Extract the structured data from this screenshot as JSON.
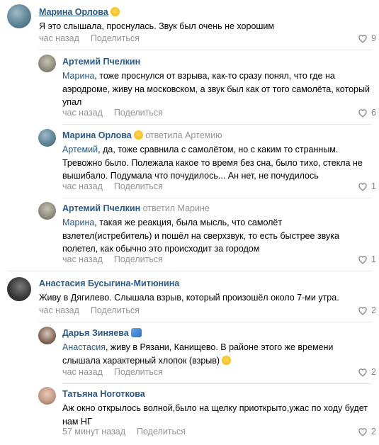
{
  "colors": {
    "link": "#2a5885",
    "meta": "#939393",
    "divider": "#e7e8ec"
  },
  "comments": [
    {
      "author": "Марина Орлова",
      "reply_to": "",
      "text_mention": "",
      "text": "Я это слышала, проснулась. Звук был очень не хорошим",
      "time": "час назад",
      "share": "Поделиться",
      "likes": "9",
      "avatar_icon": "avatar-photo",
      "badge_icon": "smiley-emoji"
    },
    {
      "author": "Артемий Пчелкин",
      "reply_to": "",
      "text_mention": "Марина",
      "text": ", тоже проснулся от взрыва, как-то сразу понял, что где на аэродроме, живу на московском, а звук был как от того самолёта, который упал",
      "time": "час назад",
      "share": "Поделиться",
      "likes": "6",
      "avatar_icon": "avatar-photo"
    },
    {
      "author": "Марина Орлова",
      "reply_to": "ответила Артемию",
      "text_mention": "Артемий",
      "text": ", да, тоже сравнила с самолётом, но с каким то странным. Тревожно было. Полежала какое то время без сна, было тихо, стекла не вышибало. Подумала что почудилось... Ан нет, не почудилось",
      "time": "час назад",
      "share": "Поделиться",
      "likes": "1",
      "avatar_icon": "avatar-photo",
      "badge_icon": "smiley-emoji"
    },
    {
      "author": "Артемий Пчелкин",
      "reply_to": "ответил Марине",
      "text_mention": "Марина",
      "text": ", такая же реакция, была мысль, что самолёт взлетел(истребитель) и пошёл на сверхзвук, то есть быстрее звука полетел, как обычно это происходит за городом",
      "time": "час назад",
      "share": "Поделиться",
      "likes": "1",
      "avatar_icon": "avatar-photo"
    },
    {
      "author": "Анастасия Бусыгина-Митюнина",
      "reply_to": "",
      "text_mention": "",
      "text": "Живу в Дягилево. Слышала взрыв, который произошёл около 7-ми утра.",
      "time": "час назад",
      "share": "Поделиться",
      "likes": "2",
      "avatar_icon": "avatar-photo"
    },
    {
      "author": "Дарья Зиняева",
      "reply_to": "",
      "text_mention": "Анастасия",
      "text": ", живу в Рязани, Канищево. В районе этого же времени слышала характерный хлопок (взрыв)",
      "time": "час назад",
      "share": "Поделиться",
      "likes": "2",
      "avatar_icon": "avatar-photo",
      "badge_icon": "sneaker-emoji",
      "trail_icon": "flushed-emoji"
    },
    {
      "author": "Татьяна Ноготкова",
      "reply_to": "",
      "text_mention": "",
      "text": "Аж окно открылось волной,было на щелку приоткрыто,ужас по ходу будет нам НГ",
      "time": "57 минут назад",
      "share": "Поделиться",
      "likes": "2",
      "avatar_icon": "avatar-photo"
    }
  ]
}
